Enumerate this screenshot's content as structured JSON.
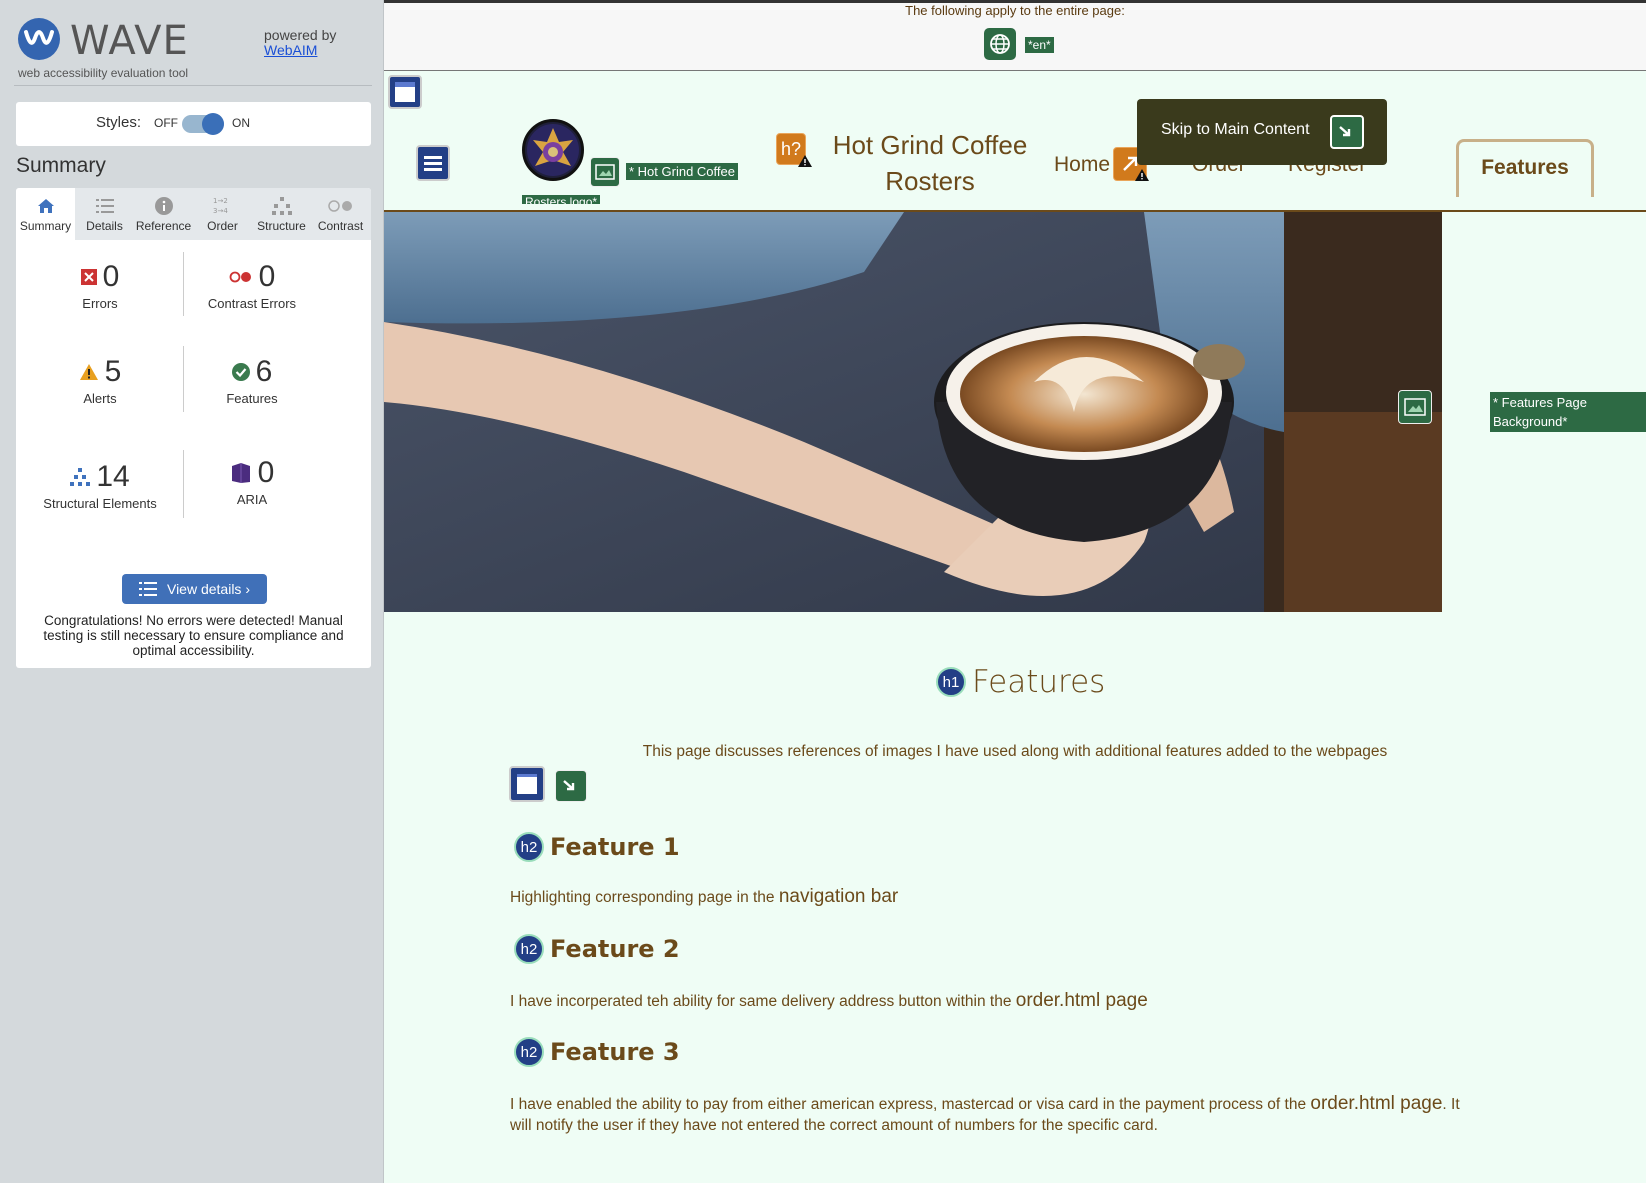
{
  "sidebar": {
    "brand": "WAVE",
    "subtitle": "web accessibility evaluation tool",
    "powered_by": "powered by",
    "webaim": "WebAIM",
    "styles_label": "Styles:",
    "styles_off": "OFF",
    "styles_on": "ON",
    "summary_title": "Summary",
    "tabs": [
      {
        "label": "Summary",
        "icon": "home-icon"
      },
      {
        "label": "Details",
        "icon": "list-icon"
      },
      {
        "label": "Reference",
        "icon": "info-icon"
      },
      {
        "label": "Order",
        "icon": "order-icon"
      },
      {
        "label": "Structure",
        "icon": "structure-icon"
      },
      {
        "label": "Contrast",
        "icon": "contrast-icon"
      }
    ],
    "stats": {
      "errors": {
        "value": "0",
        "label": "Errors"
      },
      "contrast_errors": {
        "value": "0",
        "label": "Contrast Errors"
      },
      "alerts": {
        "value": "5",
        "label": "Alerts"
      },
      "features": {
        "value": "6",
        "label": "Features"
      },
      "structural": {
        "value": "14",
        "label": "Structural Elements"
      },
      "aria": {
        "value": "0",
        "label": "ARIA"
      }
    },
    "view_details": "View details ›",
    "congrats": "Congratulations! No errors were detected! Manual testing is still necessary to ensure compliance and optimal accessibility."
  },
  "page": {
    "apply_text": "The following apply to the entire page:",
    "lang_tag": "*en*",
    "logo_alt": "* Hot Grind Coffee",
    "logo_alt2": "Rosters logo*",
    "site_title": "Hot Grind Coffee Rosters",
    "skip_link": "Skip to Main Content",
    "nav": [
      {
        "label": "Home"
      },
      {
        "label": "Order"
      },
      {
        "label": "Register"
      },
      {
        "label": "Features"
      }
    ],
    "bg_tag": "* Features Page Background*",
    "h1": "Features",
    "intro": "This page discusses references of images I have used along with additional features added to the webpages",
    "features": [
      {
        "heading": "Feature 1",
        "text": "Highlighting corresponding page in the ",
        "text_big": "navigation bar",
        "text_after": ""
      },
      {
        "heading": "Feature 2",
        "text": "I have incorperated teh ability for same delivery address button within the ",
        "text_big": "order.html page",
        "text_after": ""
      },
      {
        "heading": "Feature 3",
        "text": "I have enabled the ability to pay from either american express, mastercad or visa card in the payment process of the ",
        "text_big": "order.html page",
        "text_after": ". It will notify the user if they have not entered the correct amount of numbers for the specific card."
      }
    ],
    "h1_badge": "h1",
    "h2_badge": "h2",
    "h_missing_badge": "h?"
  },
  "colors": {
    "brown": "#6b4a1a",
    "wave_blue": "#3465b0",
    "icon_green": "#2d6a44",
    "icon_navy": "#233f86",
    "page_bg": "#effdf5"
  }
}
